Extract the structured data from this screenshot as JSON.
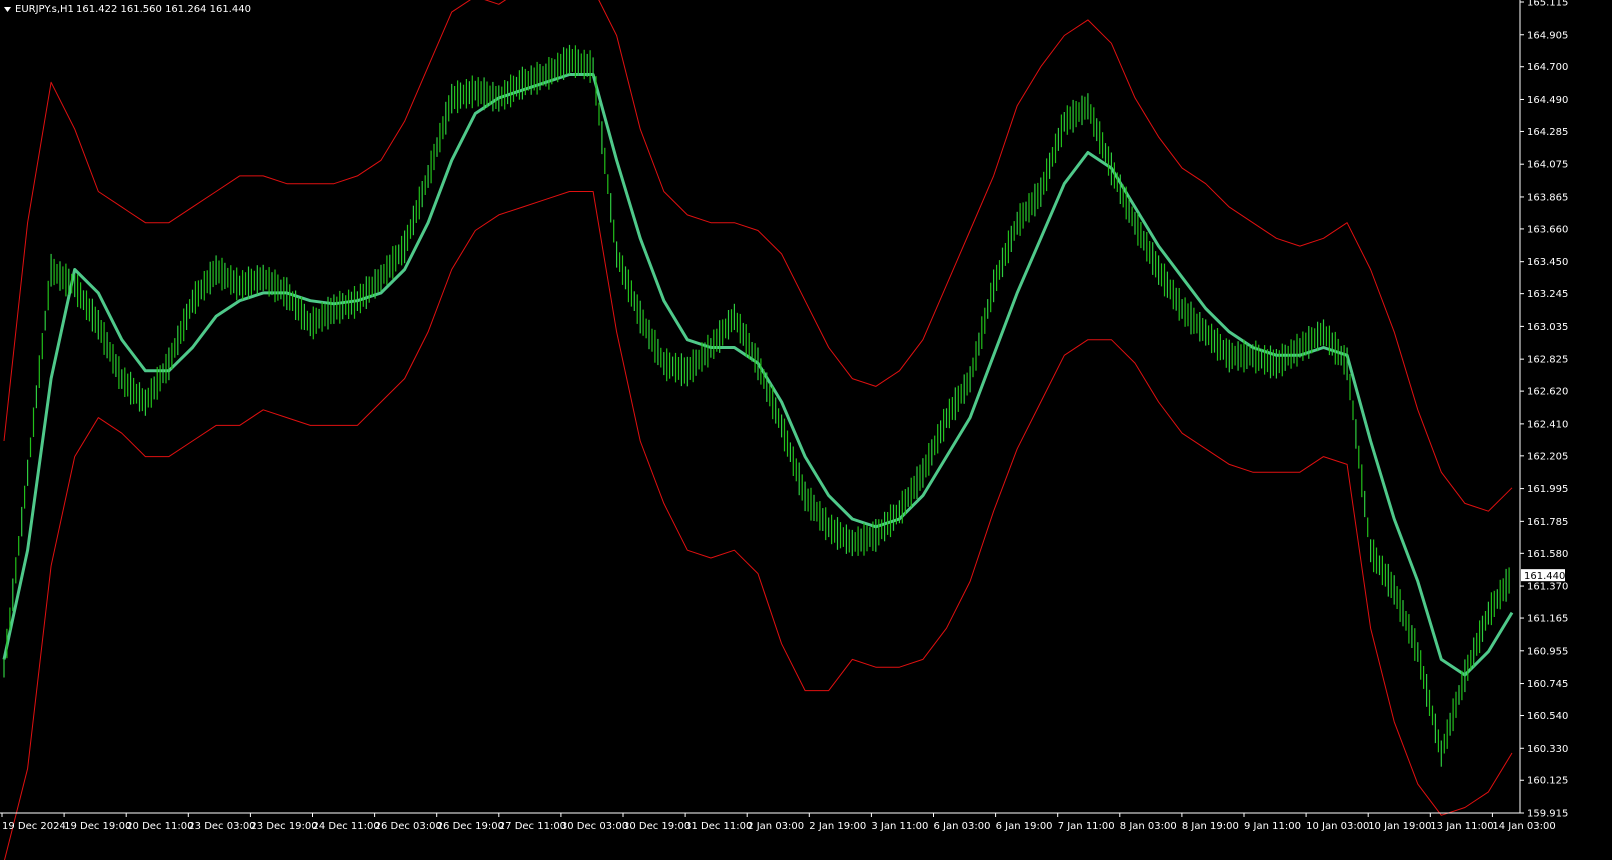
{
  "header": {
    "symbol_label": "EURJPY.s,H1",
    "ohlc": "161.422 161.560 161.264 161.440",
    "menu_icon": "triangle-down-icon"
  },
  "colors": {
    "background": "#000000",
    "axis": "#ffffff",
    "candle_up": "#2ecc40",
    "candle_line": "#22c01a",
    "ma": "#4fc98a",
    "envelope": "#e01010",
    "price_tag_bg": "#ffffff"
  },
  "chart_data": {
    "type": "line",
    "instrument": "EURJPY.s",
    "timeframe": "H1",
    "last_price": 161.44,
    "last_price_label": "161.440",
    "ylim": [
      159.915,
      165.115
    ],
    "y_ticks": [
      "165.115",
      "164.905",
      "164.700",
      "164.490",
      "164.285",
      "164.075",
      "163.865",
      "163.660",
      "163.450",
      "163.245",
      "163.035",
      "162.825",
      "162.620",
      "162.410",
      "162.205",
      "161.995",
      "161.785",
      "161.580",
      "161.370",
      "161.165",
      "160.955",
      "160.745",
      "160.540",
      "160.330",
      "160.125",
      "159.915"
    ],
    "x_ticks": [
      "19 Dec 2024",
      "19 Dec 19:00",
      "20 Dec 11:00",
      "23 Dec 03:00",
      "23 Dec 19:00",
      "24 Dec 11:00",
      "26 Dec 03:00",
      "26 Dec 19:00",
      "27 Dec 11:00",
      "30 Dec 03:00",
      "30 Dec 19:00",
      "31 Dec 11:00",
      "2 Jan 03:00",
      "2 Jan 19:00",
      "3 Jan 11:00",
      "6 Jan 03:00",
      "6 Jan 19:00",
      "7 Jan 11:00",
      "8 Jan 03:00",
      "8 Jan 19:00",
      "9 Jan 11:00",
      "10 Jan 03:00",
      "10 Jan 19:00",
      "13 Jan 11:00",
      "14 Jan 03:00"
    ],
    "price_series": [
      160.85,
      162.1,
      163.4,
      163.3,
      163.05,
      162.7,
      162.55,
      162.8,
      163.2,
      163.4,
      163.3,
      163.35,
      163.25,
      163.05,
      163.15,
      163.2,
      163.35,
      163.55,
      164.0,
      164.5,
      164.55,
      164.5,
      164.6,
      164.65,
      164.75,
      164.7,
      163.5,
      163.1,
      162.8,
      162.75,
      162.9,
      163.1,
      162.8,
      162.4,
      161.95,
      161.75,
      161.65,
      161.7,
      161.85,
      162.1,
      162.45,
      162.7,
      163.3,
      163.7,
      163.9,
      164.35,
      164.45,
      164.05,
      163.7,
      163.4,
      163.15,
      163.0,
      162.85,
      162.85,
      162.8,
      162.9,
      163.0,
      162.8,
      161.6,
      161.35,
      160.95,
      160.3,
      160.8,
      161.2,
      161.44
    ],
    "series": [
      {
        "name": "",
        "role": "moving-average",
        "values": [
          160.9,
          161.6,
          162.7,
          163.4,
          163.25,
          162.95,
          162.75,
          162.75,
          162.9,
          163.1,
          163.2,
          163.25,
          163.25,
          163.2,
          163.18,
          163.2,
          163.25,
          163.4,
          163.7,
          164.1,
          164.4,
          164.5,
          164.55,
          164.6,
          164.65,
          164.65,
          164.1,
          163.6,
          163.2,
          162.95,
          162.9,
          162.9,
          162.8,
          162.55,
          162.2,
          161.95,
          161.8,
          161.75,
          161.8,
          161.95,
          162.2,
          162.45,
          162.85,
          163.25,
          163.6,
          163.95,
          164.15,
          164.05,
          163.8,
          163.55,
          163.35,
          163.15,
          163.0,
          162.9,
          162.85,
          162.85,
          162.9,
          162.85,
          162.3,
          161.8,
          161.4,
          160.9,
          160.8,
          160.95,
          161.2
        ]
      },
      {
        "name": "",
        "role": "envelope-upper",
        "values": [
          162.3,
          163.7,
          164.6,
          164.3,
          163.9,
          163.8,
          163.7,
          163.7,
          163.8,
          163.9,
          164.0,
          164.0,
          163.95,
          163.95,
          163.95,
          164.0,
          164.1,
          164.35,
          164.7,
          165.05,
          165.15,
          165.1,
          165.2,
          165.2,
          165.2,
          165.2,
          164.9,
          164.3,
          163.9,
          163.75,
          163.7,
          163.7,
          163.65,
          163.5,
          163.2,
          162.9,
          162.7,
          162.65,
          162.75,
          162.95,
          163.3,
          163.65,
          164.0,
          164.45,
          164.7,
          164.9,
          165.0,
          164.85,
          164.5,
          164.25,
          164.05,
          163.95,
          163.8,
          163.7,
          163.6,
          163.55,
          163.6,
          163.7,
          163.4,
          163.0,
          162.5,
          162.1,
          161.9,
          161.85,
          162.0
        ]
      },
      {
        "name": "",
        "role": "envelope-lower",
        "values": [
          159.6,
          160.2,
          161.5,
          162.2,
          162.45,
          162.35,
          162.2,
          162.2,
          162.3,
          162.4,
          162.4,
          162.5,
          162.45,
          162.4,
          162.4,
          162.4,
          162.55,
          162.7,
          163.0,
          163.4,
          163.65,
          163.75,
          163.8,
          163.85,
          163.9,
          163.9,
          163.0,
          162.3,
          161.9,
          161.6,
          161.55,
          161.6,
          161.45,
          161.0,
          160.7,
          160.7,
          160.9,
          160.85,
          160.85,
          160.9,
          161.1,
          161.4,
          161.85,
          162.25,
          162.55,
          162.85,
          162.95,
          162.95,
          162.8,
          162.55,
          162.35,
          162.25,
          162.15,
          162.1,
          162.1,
          162.1,
          162.2,
          162.15,
          161.1,
          160.5,
          160.1,
          159.9,
          159.95,
          160.05,
          160.3
        ]
      }
    ],
    "grid": false,
    "legend": "none"
  }
}
